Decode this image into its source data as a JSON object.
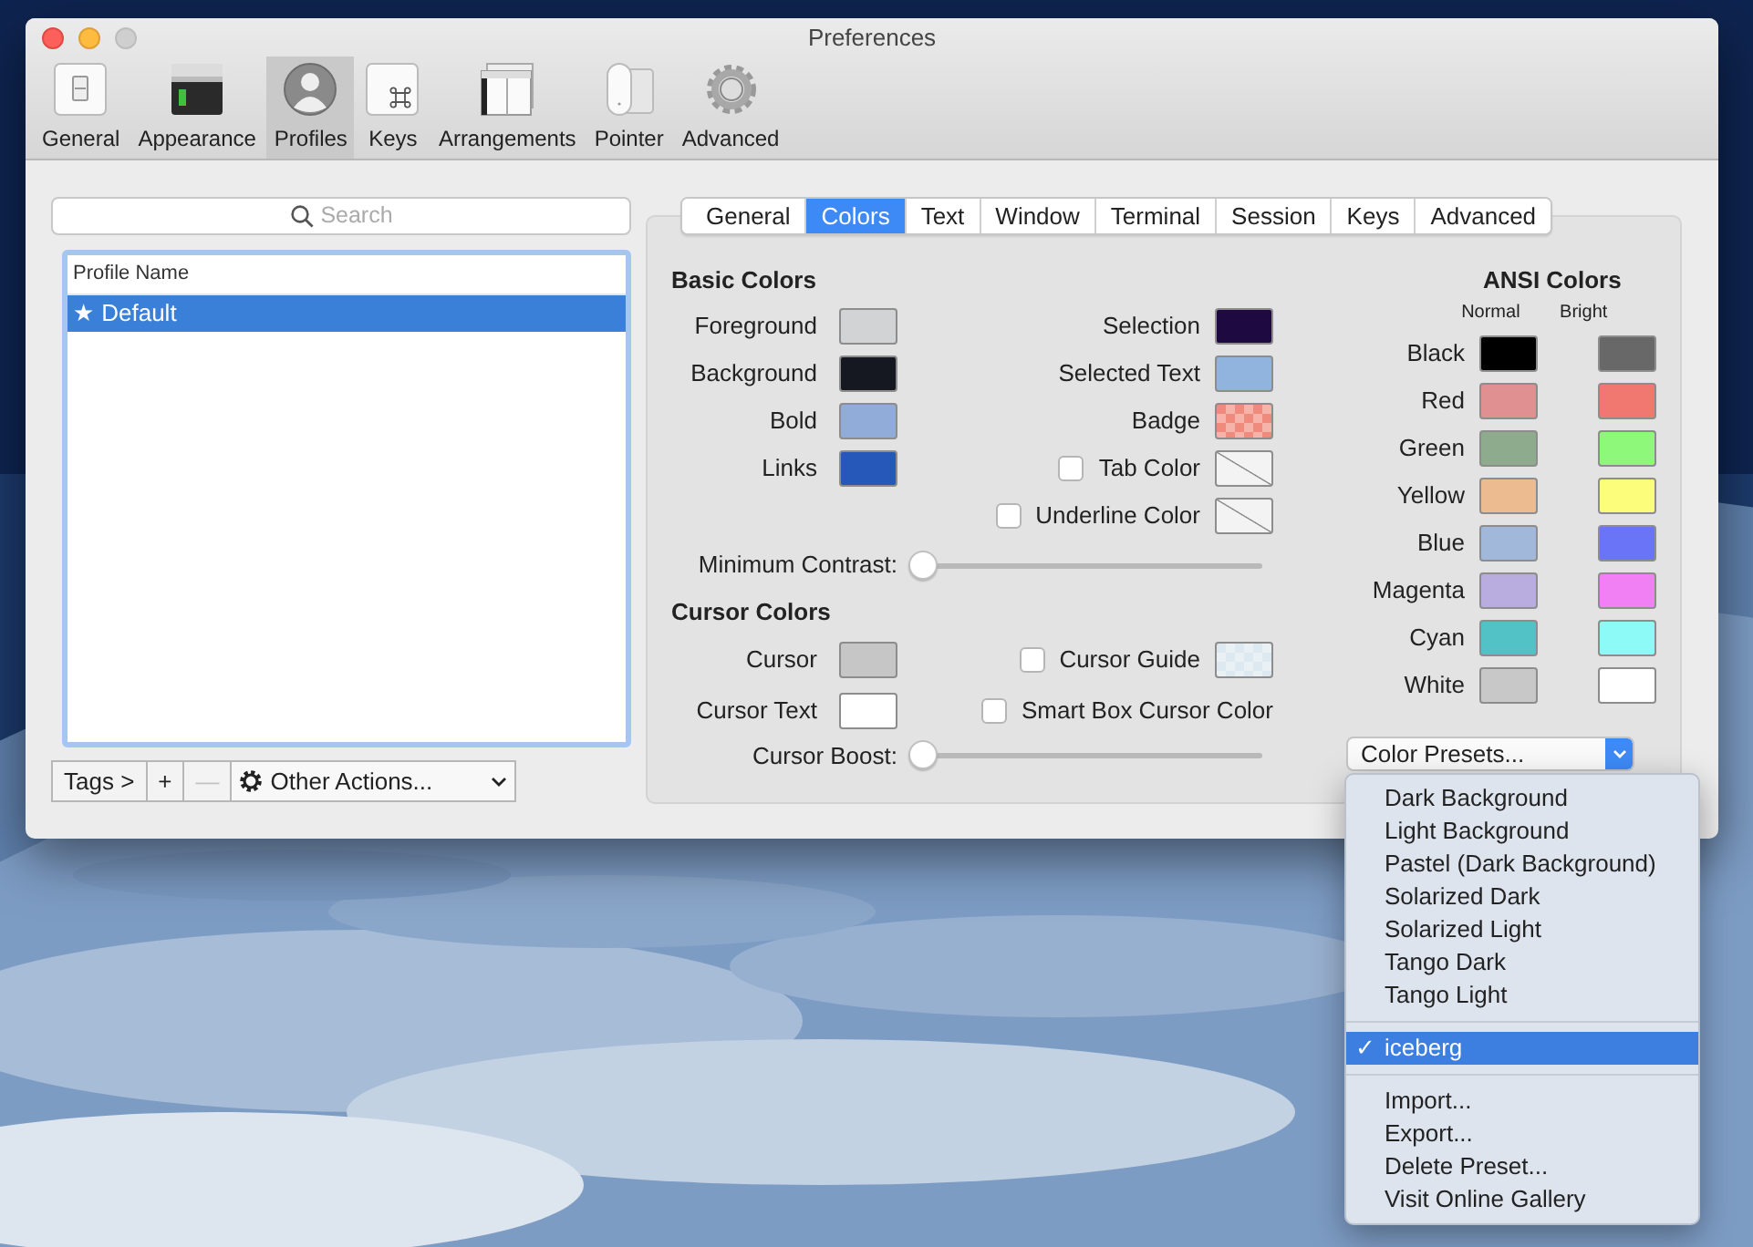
{
  "window": {
    "title": "Preferences"
  },
  "toolbar": [
    {
      "label": "General",
      "kind": "toggle",
      "selected": false
    },
    {
      "label": "Appearance",
      "kind": "terminal",
      "selected": false
    },
    {
      "label": "Profiles",
      "kind": "person",
      "selected": true
    },
    {
      "label": "Keys",
      "kind": "key",
      "selected": false
    },
    {
      "label": "Arrangements",
      "kind": "windows",
      "selected": false
    },
    {
      "label": "Pointer",
      "kind": "mouse",
      "selected": false
    },
    {
      "label": "Advanced",
      "kind": "gear",
      "selected": false
    }
  ],
  "profiles": {
    "search": {
      "placeholder": "Search"
    },
    "column": "Profile Name",
    "rows": [
      {
        "name": "★ Default",
        "selected": true
      }
    ],
    "buttons": [
      {
        "label": "Tags >",
        "disabled": false
      },
      {
        "label": "+",
        "disabled": false
      },
      {
        "label": "—",
        "disabled": true
      }
    ],
    "other_actions": "Other Actions..."
  },
  "tabs": [
    {
      "label": "General",
      "selected": false
    },
    {
      "label": "Colors",
      "selected": true
    },
    {
      "label": "Text",
      "selected": false
    },
    {
      "label": "Window",
      "selected": false
    },
    {
      "label": "Terminal",
      "selected": false
    },
    {
      "label": "Session",
      "selected": false
    },
    {
      "label": "Keys",
      "selected": false
    },
    {
      "label": "Advanced",
      "selected": false
    }
  ],
  "basic_colors": {
    "title": "Basic Colors",
    "left": [
      {
        "label": "Foreground",
        "kind": "solid",
        "color": "#d2d3d5"
      },
      {
        "label": "Background",
        "kind": "solid",
        "color": "#161821"
      },
      {
        "label": "Bold",
        "kind": "solid",
        "color": "#91acd9"
      },
      {
        "label": "Links",
        "kind": "solid",
        "color": "#2558b8"
      }
    ],
    "right": [
      {
        "label": "Selection",
        "kind": "solid",
        "color": "#1e0a40"
      },
      {
        "label": "Selected Text",
        "kind": "solid",
        "color": "#91b4df"
      },
      {
        "label": "Badge",
        "kind": "checker",
        "color": "#f08a7c"
      },
      {
        "label": "Tab Color",
        "kind": "none",
        "checked": false
      },
      {
        "label": "Underline Color",
        "kind": "none",
        "checked": false
      }
    ],
    "slider": {
      "label": "Minimum Contrast:",
      "level": 0
    }
  },
  "cursor_colors": {
    "title": "Cursor Colors",
    "left": [
      {
        "label": "Cursor",
        "kind": "solid",
        "color": "#c6c6c6"
      },
      {
        "label": "Cursor Text",
        "kind": "solid",
        "color": "#ffffff"
      }
    ],
    "right": [
      {
        "label": "Cursor Guide",
        "kind": "checker",
        "color": "#dde9f0",
        "checked": false
      },
      {
        "label": "Smart Box Cursor Color",
        "checked": false
      }
    ],
    "slider": {
      "label": "Cursor Boost:",
      "level": 0
    }
  },
  "ansi": {
    "title": "ANSI Colors",
    "columns": [
      "Normal",
      "Bright"
    ],
    "rows": [
      {
        "name": "Black",
        "normal": {
          "color": "#000000"
        },
        "bright": {
          "color": "#686868"
        }
      },
      {
        "name": "Red",
        "normal": {
          "color": "#e09090"
        },
        "bright": {
          "color": "#f07870"
        }
      },
      {
        "name": "Green",
        "normal": {
          "color": "#8eab8e"
        },
        "bright": {
          "color": "#8ef87a"
        }
      },
      {
        "name": "Yellow",
        "normal": {
          "color": "#ecbc90"
        },
        "bright": {
          "color": "#fdfd7c"
        }
      },
      {
        "name": "Blue",
        "normal": {
          "color": "#a2b8da"
        },
        "bright": {
          "color": "#6a74f6"
        }
      },
      {
        "name": "Magenta",
        "normal": {
          "color": "#b9ade0"
        },
        "bright": {
          "color": "#f080f4"
        }
      },
      {
        "name": "Cyan",
        "normal": {
          "color": "#52c2c6"
        },
        "bright": {
          "color": "#8efaf8"
        }
      },
      {
        "name": "White",
        "normal": {
          "color": "#c8c8c8"
        },
        "bright": {
          "color": "#ffffff"
        }
      }
    ]
  },
  "color_presets": {
    "label": "Color Presets...",
    "menu": [
      [
        {
          "label": "Dark Background",
          "selected": false
        },
        {
          "label": "Light Background",
          "selected": false
        },
        {
          "label": "Pastel (Dark Background)",
          "selected": false
        },
        {
          "label": "Solarized Dark",
          "selected": false
        },
        {
          "label": "Solarized Light",
          "selected": false
        },
        {
          "label": "Tango Dark",
          "selected": false
        },
        {
          "label": "Tango Light",
          "selected": false
        }
      ],
      [
        {
          "label": "iceberg",
          "selected": true
        }
      ],
      [
        {
          "label": "Import...",
          "selected": false
        },
        {
          "label": "Export...",
          "selected": false
        },
        {
          "label": "Delete Preset...",
          "selected": false
        },
        {
          "label": "Visit Online Gallery",
          "selected": false
        }
      ]
    ],
    "check": "✓"
  }
}
